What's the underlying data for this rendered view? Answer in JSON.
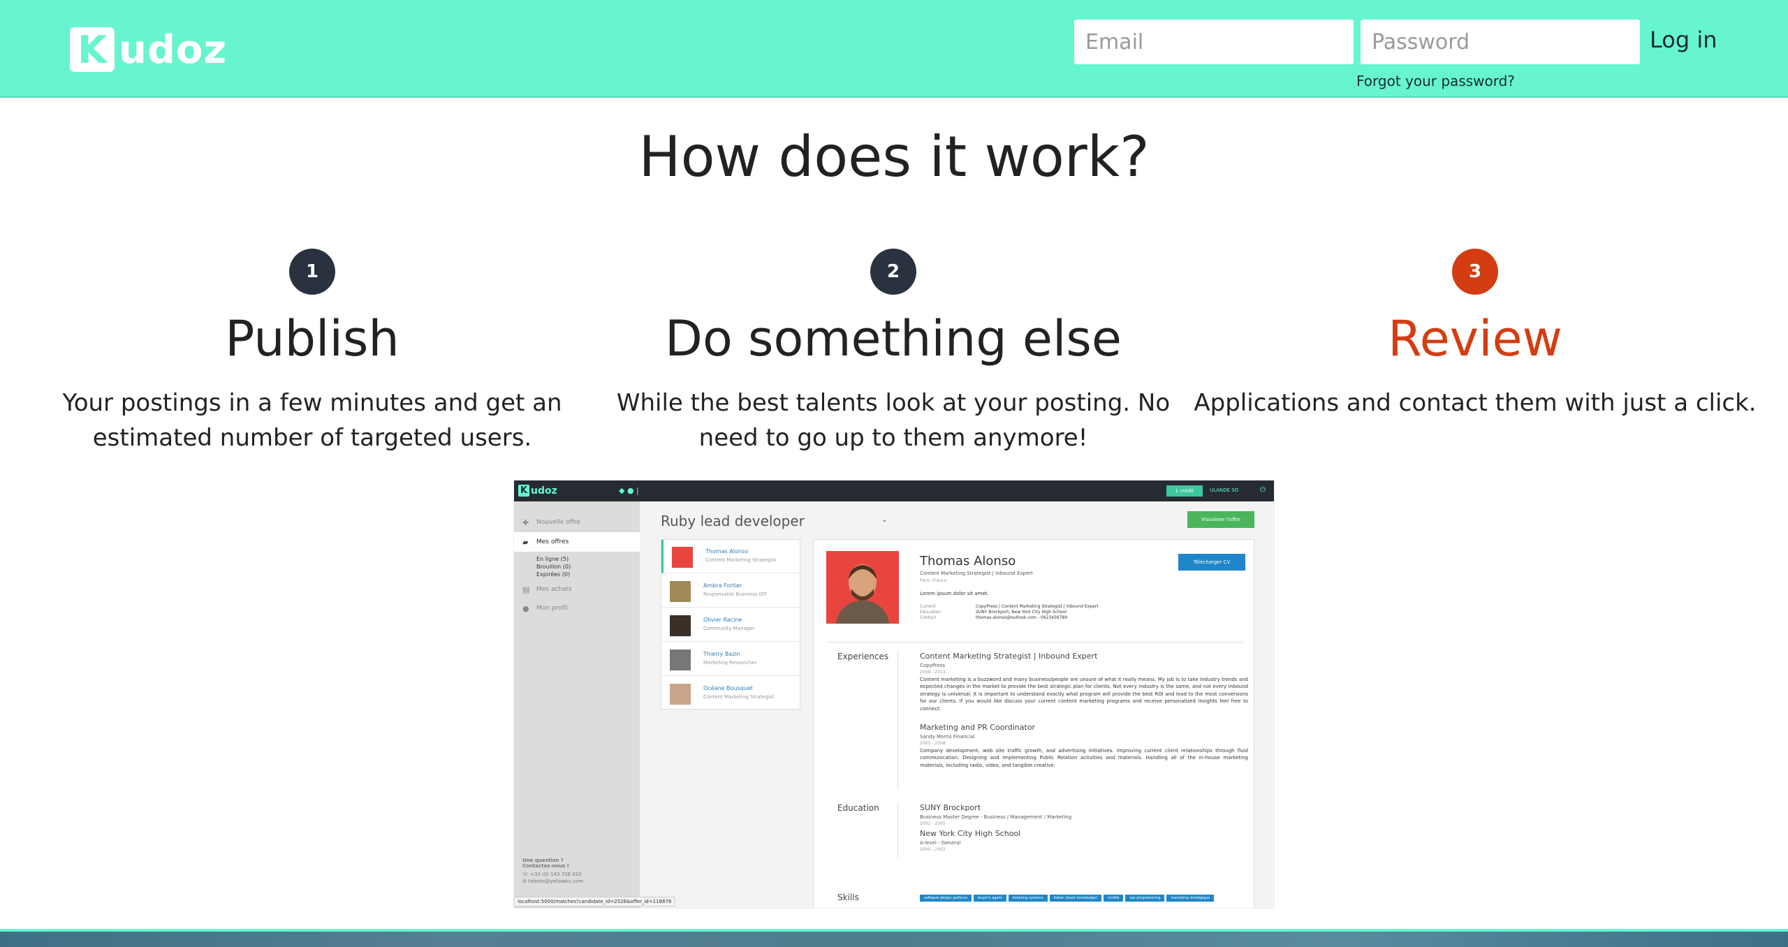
{
  "header": {
    "logo_letter": "K",
    "logo_text": "udoz",
    "email_placeholder": "Email",
    "password_placeholder": "Password",
    "login_label": "Log in",
    "forgot_label": "Forgot your password?"
  },
  "hero": {
    "title": "How does it work?"
  },
  "steps": [
    {
      "number": "1",
      "title": "Publish",
      "desc_line1": "Your postings in a few minutes and get an",
      "desc_line2": "estimated number of targeted users."
    },
    {
      "number": "2",
      "title": "Do something else",
      "desc_line1": "While the best talents look at your posting. No",
      "desc_line2": "need to go up to them anymore!"
    },
    {
      "number": "3",
      "title": "Review",
      "desc_line1": "Applications and contact them with just a click.",
      "desc_line2": ""
    }
  ],
  "colors": {
    "brand": "#66f5cf",
    "dark": "#2a3240",
    "accent": "#d43d12"
  },
  "app": {
    "logo_letter": "K",
    "logo_text": "udoz",
    "top_button": "1 crédit",
    "top_user": "ULANDE SO",
    "sidebar": {
      "new_offer": "Nouvelle offre",
      "my_offers": "Mes offres",
      "online": "En ligne (5)",
      "draft": "Brouillon (0)",
      "expired": "Expirées (0)",
      "purchases": "Mes achats",
      "profile": "Mon profil",
      "question": "Une question ?",
      "contact": "Contactez-nous !",
      "phone": "+33 (0) 143 736 820",
      "email": "talents@yellowkx.com"
    },
    "job_title": "Ruby lead developer",
    "job_dash": "-",
    "view_offer": "Visualiser l'offre",
    "candidates": [
      {
        "name": "Thomas Alonso",
        "role": "Content Marketing Strategist"
      },
      {
        "name": "Ambra Fortier",
        "role": "Responsable Business IDF"
      },
      {
        "name": "Olivier Racine",
        "role": "Community Manager"
      },
      {
        "name": "Thierry Bazin",
        "role": "Marketing Researcher"
      },
      {
        "name": "Océane Bousquet",
        "role": "Content Marketing Strategist"
      }
    ],
    "profile": {
      "name": "Thomas Alonso",
      "headline": "Content Marketing Strategist | Inbound Expert",
      "location": "Paris, France",
      "lorem": "Lorem ipsum dolor sit amet.",
      "current_label": "Current",
      "current_value": "CopyPress | Content Marketing Strategist | Inbound Expert",
      "education_label": "Education",
      "education_value": "SUNY Brockport, New York City High School",
      "contact_label": "Contact",
      "contact_value": "thomas.alonso@outlook.com - 0623456789",
      "download_cv": "Télécharger CV",
      "experiences_label": "Experiences",
      "exp1_title": "Content Marketing Strategist | Inbound Expert",
      "exp1_company": "CopyPress",
      "exp1_dates": "2008 - 2014",
      "exp1_desc": "Content marketing is a buzzword and many business/people are unsure of what it really means. My job is to take industry trends and expected changes in the market to provide the best strategic plan for clients. Not every industry is the same, and not every inbound strategy is universal. It is important to understand exactly what program will provide the best ROI and lead to the most conversions for our clients. If you would like discuss your current content marketing programs and receive personalized insights feel free to connect.",
      "exp2_title": "Marketing and PR Coordinator",
      "exp2_company": "Sandy Morris Financial",
      "exp2_dates": "2005 - 2008",
      "exp2_desc": "Company development, web site traffic growth, and advertising initiatives. Improving current client relationships through fluid communication. Designing and implementing Public Relation activities and materials. Handling all of the in-house marketing materials, including radio, video, and tangible creative.",
      "education_section": "Education",
      "edu1_title": "SUNY Brockport",
      "edu1_sub": "Business Master Degree - Business / Management / Marketing",
      "edu1_dates": "2002 - 2005",
      "edu2_title": "New York City High School",
      "edu2_sub": "A-level - General",
      "edu2_dates": "2000 - 2002",
      "skills_label": "Skills",
      "skills": [
        "software design patterns",
        "buyer's agent",
        "ticketing systems",
        "italian (basic knowledge)",
        "civilité",
        "sas programming",
        "marketing stratégique"
      ]
    },
    "status_url": "localhost:5000/matches?candidate_id=2526&offer_id=118878"
  }
}
